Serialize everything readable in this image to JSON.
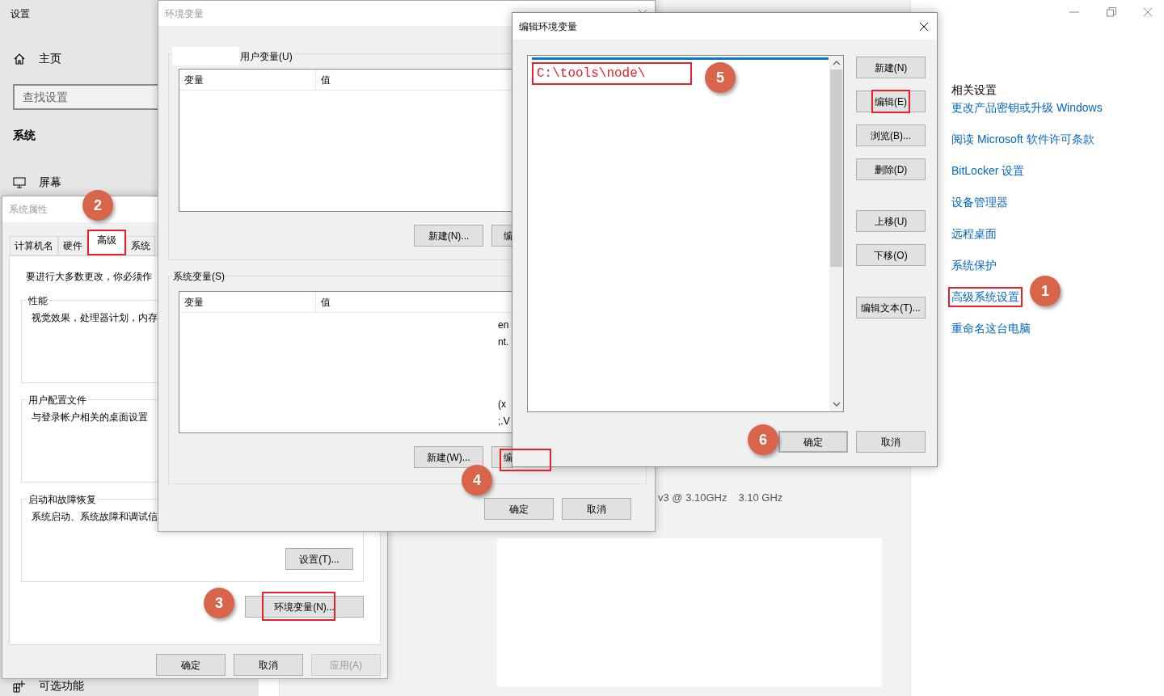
{
  "settings": {
    "title": "设置",
    "home": "主页",
    "search": {
      "placeholder": "查找设置"
    },
    "category": "系统",
    "nav": [
      {
        "label": "屏幕",
        "kind": "monitor"
      },
      {
        "label": "可选功能",
        "kind": "apps"
      }
    ],
    "processor": "v3 @ 3.10GHz",
    "speed": "3.10 GHz",
    "related": {
      "heading": "相关设置",
      "links": [
        {
          "label": "更改产品密钥或升级 Windows",
          "highlighted": false
        },
        {
          "label": "阅读 Microsoft 软件许可条款",
          "highlighted": false
        },
        {
          "label": "BitLocker 设置",
          "highlighted": false
        },
        {
          "label": "设备管理器",
          "highlighted": false
        },
        {
          "label": "远程桌面",
          "highlighted": false
        },
        {
          "label": "系统保护",
          "highlighted": false
        },
        {
          "label": "高级系统设置",
          "highlighted": true,
          "callout": "1"
        },
        {
          "label": "重命名这台电脑",
          "highlighted": false
        }
      ]
    }
  },
  "system_properties": {
    "title": "系统属性",
    "tabs": [
      {
        "label": "计算机名",
        "selected": false,
        "highlighted": false
      },
      {
        "label": "硬件",
        "selected": false,
        "highlighted": false
      },
      {
        "label": "高级",
        "selected": true,
        "highlighted": true,
        "callout": "2"
      },
      {
        "label": "系统",
        "selected": false,
        "highlighted": false
      }
    ],
    "notice": "要进行大多数更改，你必须作",
    "groups": [
      {
        "title": "性能",
        "text": "视觉效果，处理器计划，内存"
      },
      {
        "title": "用户配置文件",
        "text": "与登录帐户相关的桌面设置"
      },
      {
        "title": "启动和故障恢复",
        "text": "系统启动、系统故障和调试信",
        "button": "设置(T)..."
      }
    ],
    "env_button": {
      "label": "环境变量(N)...",
      "highlighted": true,
      "callout": "3"
    },
    "buttons": [
      {
        "label": "确定",
        "disabled": false
      },
      {
        "label": "取消",
        "disabled": false
      },
      {
        "label": "应用(A)",
        "disabled": true
      }
    ]
  },
  "environment_variables": {
    "title": "环境变量",
    "user": {
      "label": "用户变量(U)",
      "columns": [
        "变量",
        "值"
      ],
      "buttons": [
        {
          "label": "新建(N)...",
          "highlighted": false
        },
        {
          "label": "编",
          "highlighted": false
        }
      ]
    },
    "system": {
      "label": "系统变量(S)",
      "columns": [
        "变量",
        "值"
      ],
      "value_fragments": [
        "en",
        "nt.",
        "(x",
        ";.V"
      ],
      "buttons": [
        {
          "label": "新建(W)...",
          "highlighted": false
        },
        {
          "label": "编",
          "highlighted": true,
          "callout": "4"
        }
      ]
    },
    "buttons": [
      "确定",
      "取消"
    ]
  },
  "edit_variable": {
    "title": "编辑环境变量",
    "entries": [
      {
        "text": "C:\\tools\\node\\",
        "highlighted": true,
        "callout": "5"
      }
    ],
    "buttons": [
      {
        "label": "新建(N)",
        "highlighted": false
      },
      {
        "label": "编辑(E)",
        "highlighted": true
      },
      {
        "label": "浏览(B)...",
        "highlighted": false
      },
      {
        "label": "删除(D)",
        "highlighted": false
      },
      {
        "label": "上移(U)",
        "highlighted": false
      },
      {
        "label": "下移(O)",
        "highlighted": false
      },
      {
        "label": "编辑文本(T)...",
        "highlighted": false
      }
    ],
    "ok": {
      "label": "确定",
      "focused": true,
      "callout": "6"
    },
    "cancel": "取消"
  }
}
